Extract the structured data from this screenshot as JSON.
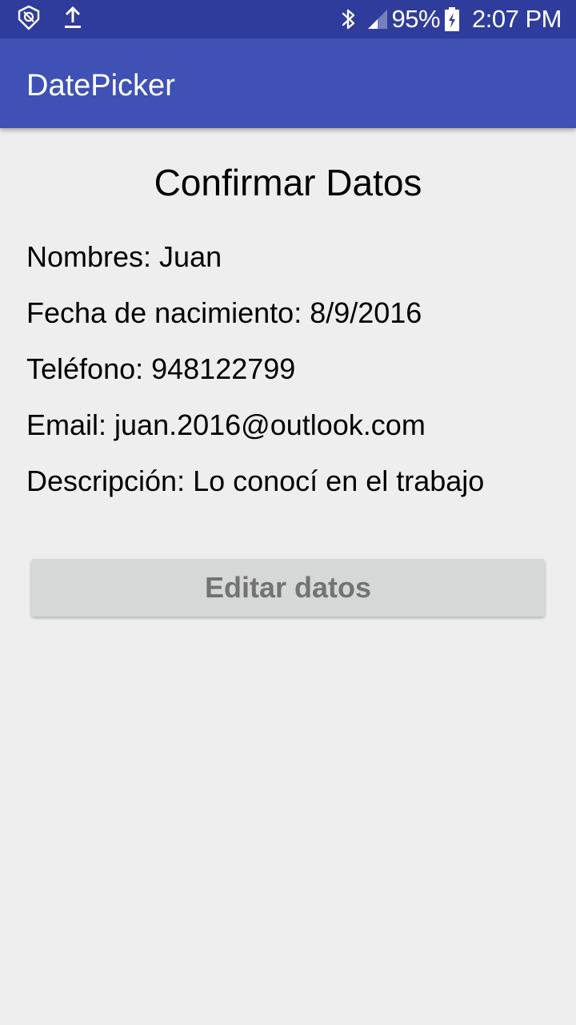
{
  "status_bar": {
    "battery": "95%",
    "time": "2:07 PM",
    "icons": [
      "app-notification-icon",
      "upload-icon",
      "bluetooth-icon",
      "signal-icon",
      "battery-charging-icon"
    ]
  },
  "app_bar": {
    "title": "DatePicker",
    "color": "#3f51b5"
  },
  "content": {
    "heading": "Confirmar Datos",
    "fields": {
      "nombres": "Nombres: Juan",
      "fecha": "Fecha de nacimiento: 8/9/2016",
      "telefono": "Teléfono: 948122799",
      "email": "Email: juan.2016@outlook.com",
      "descripcion": "Descripción: Lo conocí en el trabajo"
    },
    "edit_button_label": "Editar datos"
  }
}
